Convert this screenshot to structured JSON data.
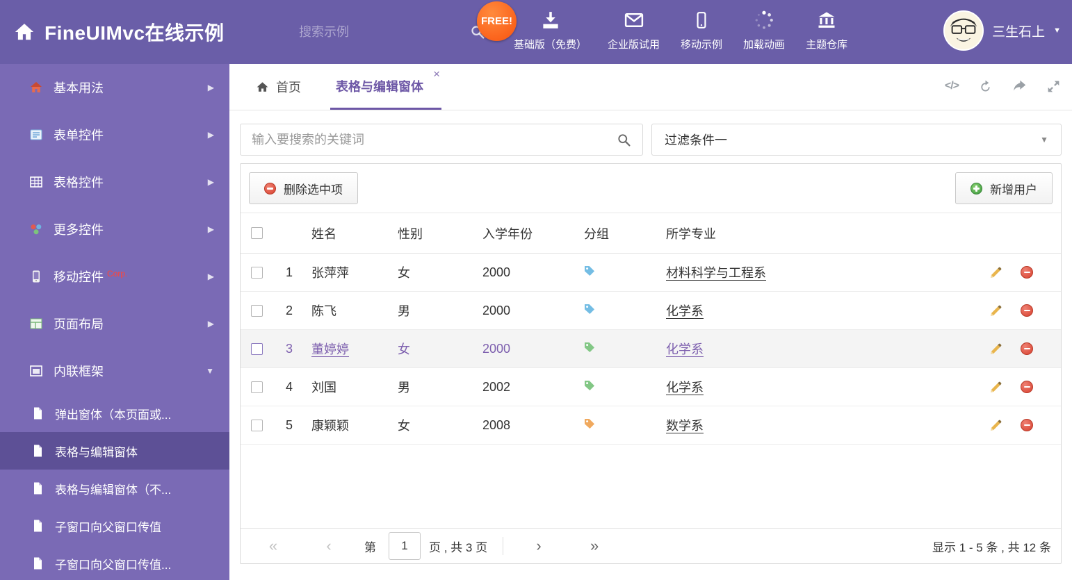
{
  "colors": {
    "header-bg": "#6a5ea8",
    "sidebar-bg": "#7a6ab5",
    "sidebar-selected": "#5d5096",
    "accent": "#6d57a6",
    "selected-text": "#7d5fae",
    "danger": "#d8402f",
    "success": "#3f9b3f",
    "free-badge": "#f9530f"
  },
  "icons": {
    "caret_down": "▼",
    "chevron_right": "▶",
    "close": "×",
    "code": "</>",
    "first": "«",
    "prev": "‹",
    "next": "›",
    "last": "»"
  },
  "header": {
    "title": "FineUIMvc在线示例",
    "search_placeholder": "搜索示例",
    "free_badge": "FREE!",
    "nav": [
      {
        "label": "基础版（免费）",
        "icon": "download-icon"
      },
      {
        "label": "企业版试用",
        "icon": "envelope-icon"
      },
      {
        "label": "移动示例",
        "icon": "mobile-icon"
      },
      {
        "label": "加载动画",
        "icon": "spinner-icon"
      },
      {
        "label": "主题仓库",
        "icon": "bank-icon"
      }
    ],
    "user_name": "三生石上"
  },
  "sidebar": {
    "items": [
      {
        "label": "基本用法",
        "icon": "home-icon"
      },
      {
        "label": "表单控件",
        "icon": "form-icon"
      },
      {
        "label": "表格控件",
        "icon": "table-icon"
      },
      {
        "label": "更多控件",
        "icon": "widgets-icon"
      },
      {
        "label": "移动控件",
        "badge": "Corp.",
        "icon": "mobile-icon"
      },
      {
        "label": "页面布局",
        "icon": "layout-icon"
      },
      {
        "label": "内联框架",
        "icon": "frame-icon",
        "expanded": true
      }
    ],
    "subitems": [
      {
        "label": "弹出窗体（本页面或..."
      },
      {
        "label": "表格与编辑窗体",
        "selected": true
      },
      {
        "label": "表格与编辑窗体（不..."
      },
      {
        "label": "子窗口向父窗口传值"
      },
      {
        "label": "子窗口向父窗口传值..."
      }
    ]
  },
  "tabs": {
    "home_label": "首页",
    "active_label": "表格与编辑窗体"
  },
  "filter": {
    "search_placeholder": "输入要搜索的关键词",
    "dropdown_value": "过滤条件一"
  },
  "toolbar": {
    "delete_label": "删除选中项",
    "add_label": "新增用户"
  },
  "table": {
    "columns": {
      "name": "姓名",
      "gender": "性别",
      "year": "入学年份",
      "group": "分组",
      "major": "所学专业"
    },
    "rows": [
      {
        "num": "1",
        "name": "张萍萍",
        "gender": "女",
        "year": "2000",
        "tag": "blue",
        "major": "材料科学与工程系"
      },
      {
        "num": "2",
        "name": "陈飞",
        "gender": "男",
        "year": "2000",
        "tag": "blue",
        "major": "化学系"
      },
      {
        "num": "3",
        "name": "董婷婷",
        "gender": "女",
        "year": "2000",
        "tag": "green",
        "major": "化学系",
        "selected": true
      },
      {
        "num": "4",
        "name": "刘国",
        "gender": "男",
        "year": "2002",
        "tag": "green",
        "major": "化学系"
      },
      {
        "num": "5",
        "name": "康颖颖",
        "gender": "女",
        "year": "2008",
        "tag": "orange",
        "major": "数学系"
      }
    ]
  },
  "pager": {
    "label_page": "第",
    "page_value": "1",
    "label_total": "页 , 共 3 页",
    "summary": "显示 1 - 5 条 , 共 12 条"
  }
}
